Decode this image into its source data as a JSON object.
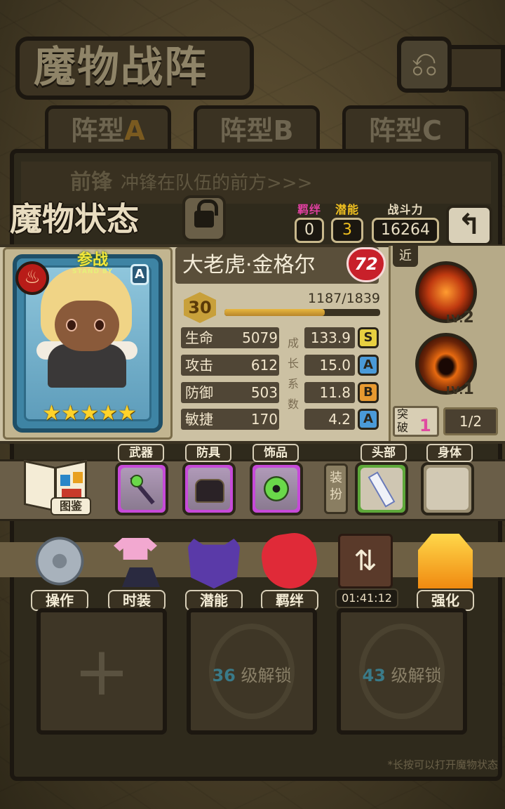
{
  "header": {
    "title": "魔物战阵",
    "back_icon": "undo-arrow-icon"
  },
  "tabs": [
    {
      "prefix": "阵型",
      "suffix": "A"
    },
    {
      "prefix": "阵型",
      "suffix": "B"
    },
    {
      "prefix": "阵型",
      "suffix": "C"
    }
  ],
  "vanguard": {
    "label": "前锋",
    "desc": "冲锋在队伍的前方>>>"
  },
  "status": {
    "title": "魔物状态",
    "bond_label": "羁绊",
    "bond_value": "0",
    "potential_label": "潜能",
    "potential_value": "3",
    "power_label": "战斗力",
    "power_value": "16264"
  },
  "monster": {
    "name": "大老虎·金格尔",
    "heart_value": "72",
    "standby_main": "参战",
    "standby_sub": "STAND BY",
    "card_rank": "A",
    "stars": 5,
    "level": "30",
    "exp_text": "1187/1839",
    "exp_fraction": 0.645,
    "growth_label": [
      "成",
      "长",
      "系",
      "数"
    ],
    "stats": [
      {
        "name": "生命",
        "value": "5079",
        "growth": "133.9",
        "rank": "S",
        "rank_color": "#e8d040"
      },
      {
        "name": "攻击",
        "value": "612",
        "growth": "15.0",
        "rank": "A",
        "rank_color": "#4a9ad8"
      },
      {
        "name": "防御",
        "value": "503",
        "growth": "11.8",
        "rank": "B",
        "rank_color": "#e89a30"
      },
      {
        "name": "敏捷",
        "value": "170",
        "growth": "4.2",
        "rank": "A",
        "rank_color": "#4a9ad8"
      }
    ],
    "type_tag": "近",
    "skills": [
      {
        "icon": "tiger-skill-icon",
        "lv_label": "LV:",
        "lv": "2"
      },
      {
        "icon": "dark-eye-skill-icon",
        "lv_label": "LV:",
        "lv": "1"
      }
    ],
    "breakthrough_label": "突破",
    "breakthrough_value": "1",
    "breakthrough_ratio": "1/2"
  },
  "equipment": {
    "codex_label": "图鉴",
    "weapon_label": "武器",
    "armor_label": "防具",
    "accessory_label": "饰品",
    "dress_label": "装扮",
    "head_label": "头部",
    "body_label": "身体"
  },
  "actions": [
    {
      "label": "操作",
      "icon": "gear-icon"
    },
    {
      "label": "时装",
      "icon": "outfit-icon"
    },
    {
      "label": "潜能",
      "icon": "demon-icon"
    },
    {
      "label": "羁绊",
      "icon": "hearts-icon"
    },
    {
      "label": "",
      "icon": "swap-chest-icon",
      "timer": "01:41:12"
    },
    {
      "label": "强化",
      "icon": "upgrade-arrows-icon"
    }
  ],
  "slots": {
    "unlock1_level": "36",
    "unlock2_level": "43",
    "unlock_text": "级解锁"
  },
  "hint": "*长按可以打开魔物状态"
}
